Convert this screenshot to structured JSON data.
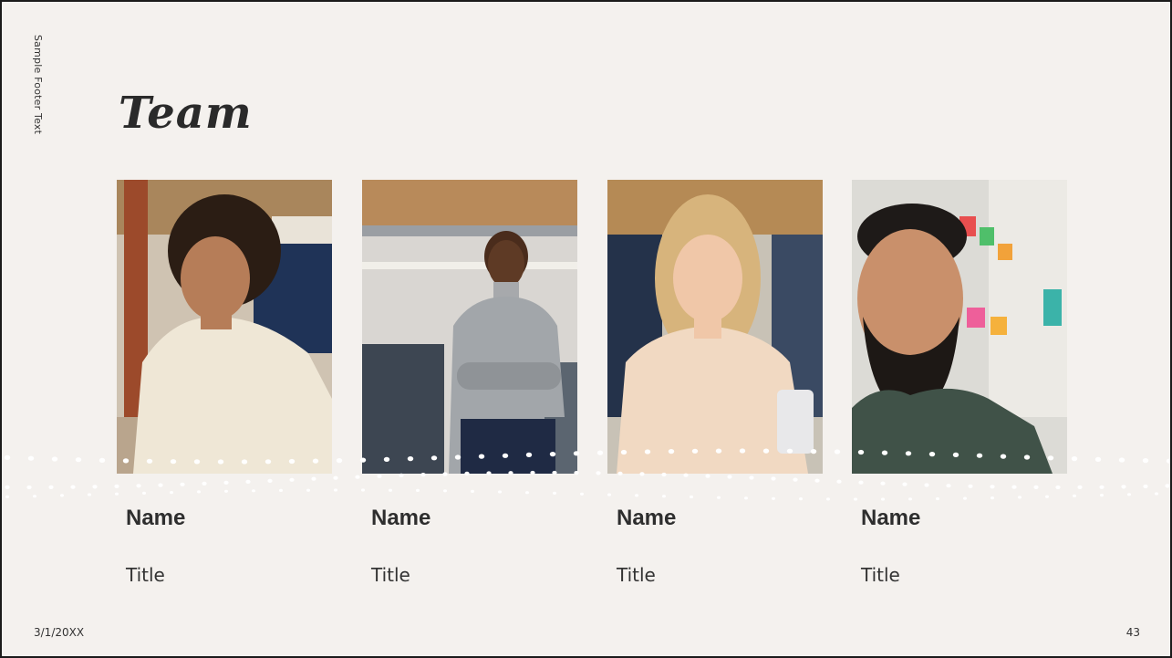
{
  "slide": {
    "footer_text": "Sample Footer Text",
    "title": "Team",
    "date": "3/1/20XX",
    "page_number": "43"
  },
  "members": [
    {
      "name": "Name",
      "title": "Title",
      "photo": "man-curly-hair-cream-sweater-photo"
    },
    {
      "name": "Name",
      "title": "Title",
      "photo": "woman-gray-turtleneck-arms-crossed-photo"
    },
    {
      "name": "Name",
      "title": "Title",
      "photo": "woman-blonde-beige-blouse-photo"
    },
    {
      "name": "Name",
      "title": "Title",
      "photo": "bearded-man-green-tshirt-photo"
    }
  ],
  "colors": {
    "background": "#f4f1ee",
    "text": "#2c2c2c",
    "dots": "#ffffff"
  }
}
